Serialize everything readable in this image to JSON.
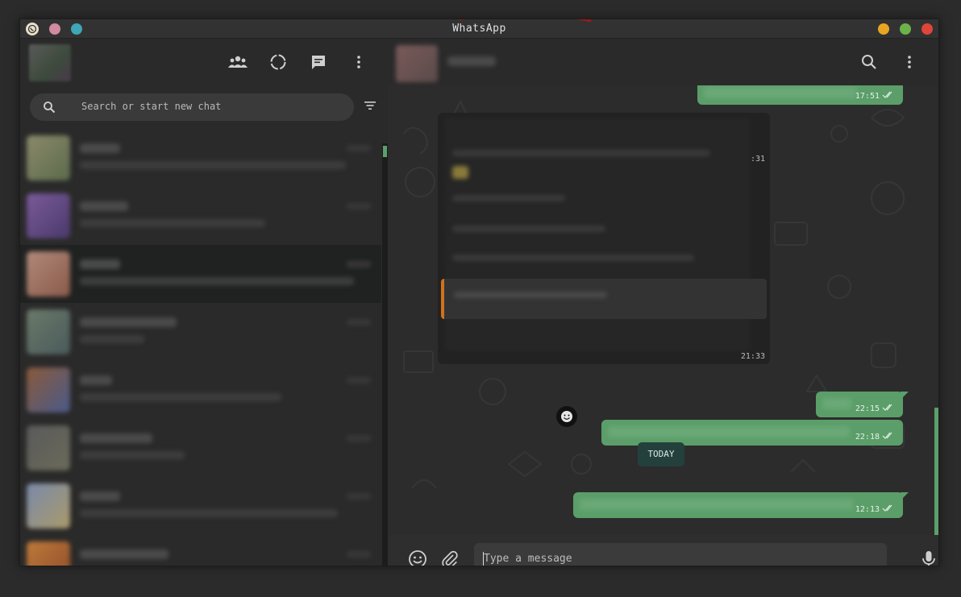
{
  "window": {
    "title": "WhatsApp",
    "traffic_left": [
      "#d18aa0",
      "#3fa7b5"
    ],
    "traffic_right": [
      "#e8a524",
      "#6cb24a",
      "#e0453a"
    ]
  },
  "sidebar": {
    "header_icons": [
      "communities-icon",
      "status-icon",
      "new-chat-icon",
      "menu-icon"
    ],
    "search": {
      "placeholder": "Search or start new chat"
    },
    "filter_icon": "filter-icon",
    "selected_chat_index": 2
  },
  "chat": {
    "header_icons": [
      "search-icon",
      "menu-icon"
    ],
    "messages": [
      {
        "direction": "out",
        "time": "17:51",
        "status": "read"
      },
      {
        "direction": "in",
        "time": ":31"
      },
      {
        "direction": "in",
        "time": "21:33"
      },
      {
        "direction": "out",
        "time": "22:15",
        "status": "read"
      },
      {
        "direction": "out",
        "time": "22:18",
        "status": "read"
      },
      {
        "direction": "out",
        "time": "12:13",
        "status": "read"
      }
    ],
    "date_divider": "TODAY",
    "composer": {
      "placeholder": "Type a message",
      "icons": [
        "emoji-icon",
        "attach-icon",
        "mic-icon"
      ]
    }
  }
}
